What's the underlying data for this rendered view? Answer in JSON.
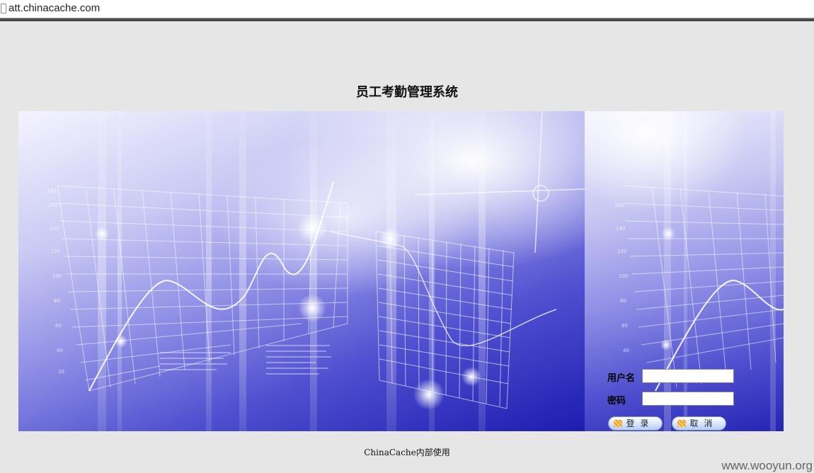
{
  "browser": {
    "url": "att.chinacache.com"
  },
  "page": {
    "title": "员工考勤管理系统",
    "footer": "ChinaCache内部使用"
  },
  "login": {
    "username_label": "用户名",
    "username_value": "",
    "password_label": "密码",
    "password_value": "",
    "login_button": "登录",
    "cancel_button": "取消"
  },
  "watermark": "www.wooyun.org",
  "colors": {
    "page_background": "#e6e6e6",
    "banner_blue": "#1c1cb0"
  }
}
